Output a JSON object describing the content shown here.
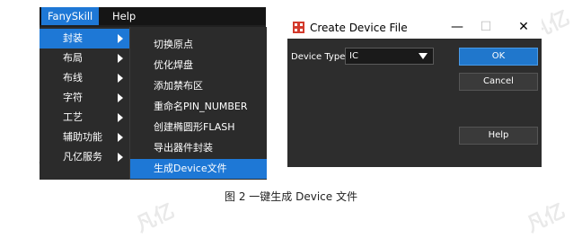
{
  "menubar": {
    "items": [
      "FanySkill",
      "Help"
    ]
  },
  "menu_l1": {
    "items": [
      "封装",
      "布局",
      "布线",
      "字符",
      "工艺",
      "辅助功能",
      "凡亿服务"
    ]
  },
  "menu_l2": {
    "items": [
      "切换原点",
      "优化焊盘",
      "添加禁布区",
      "重命名PIN_NUMBER",
      "创建椭圆形FLASH",
      "导出器件封装",
      "生成Device文件"
    ]
  },
  "dialog": {
    "title": "Create Device File",
    "titlebar": {
      "minimize": "—",
      "maximize": "☐",
      "close": "✕"
    },
    "device_type_label": "Device Type:",
    "device_type_value": "IC",
    "buttons": {
      "ok": "OK",
      "cancel": "Cancel",
      "help": "Help"
    },
    "icon_colors": [
      "#d33a2c",
      "#ffffff"
    ]
  },
  "caption": "图 2 一键生成 Device 文件",
  "watermark_text": "凡亿"
}
